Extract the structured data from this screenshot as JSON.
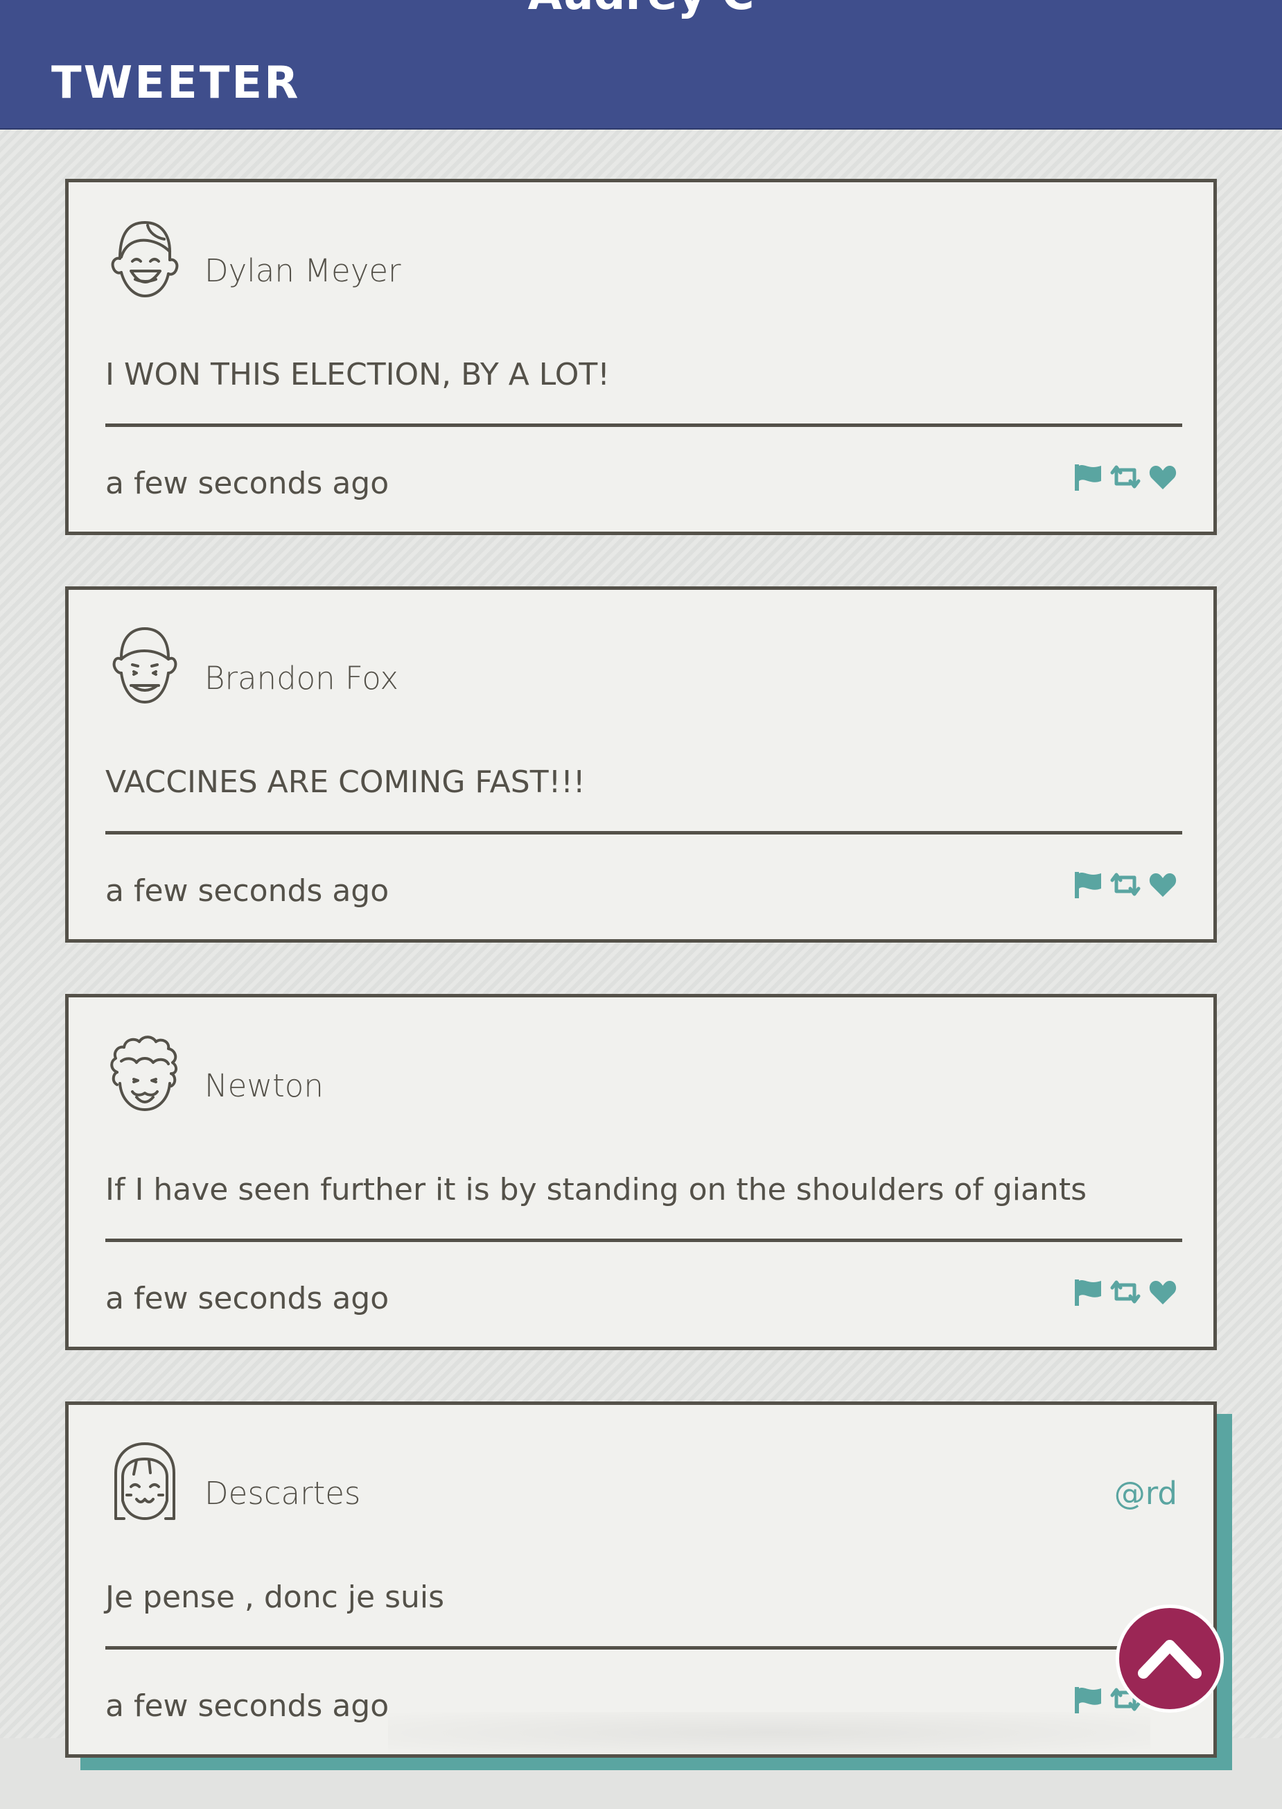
{
  "header": {
    "user_name": "Audrey C",
    "logo": "TWEETER"
  },
  "tweets": [
    {
      "name": "Dylan Meyer",
      "handle": "",
      "content": "I WON THIS ELECTION, BY A LOT!",
      "time": "a few seconds ago",
      "avatar": "laughing-boy-avatar"
    },
    {
      "name": "Brandon Fox",
      "handle": "",
      "content": "VACCINES ARE COMING FAST!!!",
      "time": "a few seconds ago",
      "avatar": "smiling-man-avatar"
    },
    {
      "name": "Newton",
      "handle": "",
      "content": "If I have seen further it is by standing on the shoulders of giants",
      "time": "a few seconds ago",
      "avatar": "curly-hair-avatar"
    },
    {
      "name": "Descartes",
      "handle": "@rd",
      "content": "Je pense , donc je suis",
      "time": "a few seconds ago",
      "avatar": "bob-hair-avatar"
    }
  ],
  "colors": {
    "header_bg": "#3f4e8c",
    "accent": "#5aa5a1",
    "scroll_button": "#9b2655",
    "border": "#545149"
  },
  "icons": [
    "flag-icon",
    "retweet-icon",
    "heart-icon",
    "chevron-up-icon"
  ]
}
